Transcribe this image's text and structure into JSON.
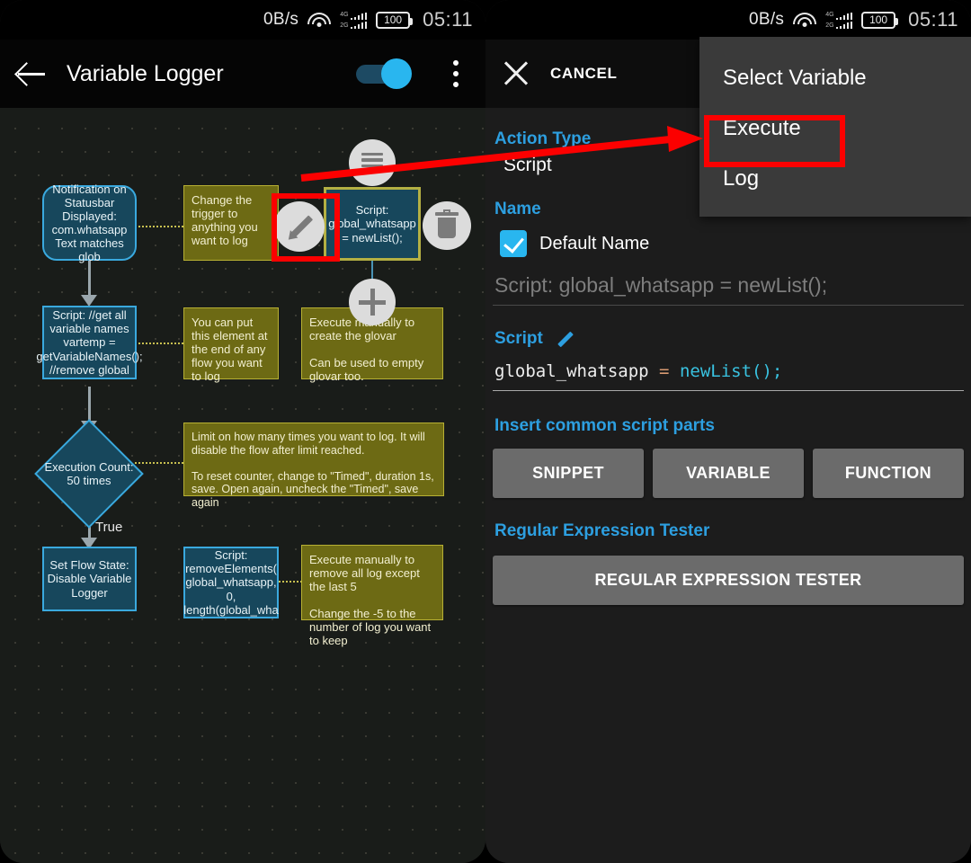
{
  "statusbar": {
    "speed": "0B/s",
    "battery": "100",
    "time": "05:11",
    "net_label_top": "4G",
    "net_label_bottom": "2G",
    "icons": [
      "wifi-icon",
      "signal-icon",
      "battery-icon"
    ]
  },
  "left_panel": {
    "appbar": {
      "title": "Variable Logger",
      "back_icon": "back-arrow-icon",
      "toggle_state": "on",
      "overflow_icon": "kebab-menu-icon"
    },
    "flow": {
      "nodes": [
        {
          "id": "trigger",
          "type": "trigger",
          "text": "Notification on Statusbar Displayed: com.whatsapp Text matches glob"
        },
        {
          "id": "script1",
          "type": "action",
          "text": "Script: //get all variable names vartemp = getVariableNames(); //remove global"
        },
        {
          "id": "count",
          "type": "condition",
          "text": "Execution Count: 50 times"
        },
        {
          "id": "flowstate",
          "type": "action",
          "text": "Set Flow State: Disable Variable Logger"
        },
        {
          "id": "script_sel",
          "type": "action-selected",
          "text": "Script: global_whatsapp = newList();"
        },
        {
          "id": "script2",
          "type": "action",
          "text": "Script: removeElements( global_whatsapp, 0, length(global_wha"
        }
      ],
      "notes": [
        {
          "id": "note1",
          "text": "Change the trigger to anything you want to log"
        },
        {
          "id": "note2",
          "text": "You can put this element at the end of any flow you want to log"
        },
        {
          "id": "note3",
          "text": "Execute manually to create the glovar\n\nCan be used to empty glovar too."
        },
        {
          "id": "note4",
          "text": "Limit on how many times you want to log. It will disable the flow after limit reached.\n\nTo reset counter, change to \"Timed\", duration 1s, save. Open again, uncheck the \"Timed\", save again"
        },
        {
          "id": "note5",
          "text": "Execute manually to remove all log except the last 5\n\nChange the -5 to the number of log you want to keep"
        }
      ],
      "edge_labels": {
        "true": "True"
      },
      "fabs": [
        {
          "id": "fab-menu",
          "icon": "hamburger-icon"
        },
        {
          "id": "fab-edit",
          "icon": "pencil-icon"
        },
        {
          "id": "fab-delete",
          "icon": "trash-icon"
        },
        {
          "id": "fab-add",
          "icon": "plus-icon"
        }
      ]
    }
  },
  "right_panel": {
    "appbar": {
      "close_icon": "close-x-icon",
      "cancel_label": "CANCEL",
      "confirm_icon": "check-icon"
    },
    "action_type": {
      "label": "Action Type",
      "value": "Script"
    },
    "name": {
      "label": "Name",
      "default_name_label": "Default Name",
      "default_name_checked": true,
      "name_placeholder": "Script: global_whatsapp = newList();"
    },
    "script": {
      "label": "Script",
      "edit_icon": "pencil-icon",
      "code_parts": {
        "var": "global_whatsapp",
        "op": "=",
        "fn": "newList();"
      },
      "code_full": "global_whatsapp = newList();"
    },
    "insert": {
      "label": "Insert common script parts",
      "buttons": [
        "SNIPPET",
        "VARIABLE",
        "FUNCTION"
      ]
    },
    "regex": {
      "label": "Regular Expression Tester",
      "button": "REGULAR EXPRESSION TESTER"
    }
  },
  "dropdown_menu": {
    "items": [
      "Select Variable",
      "Execute",
      "Log"
    ],
    "highlighted": "Execute"
  },
  "annotations": {
    "highlight_color": "#fc0000",
    "boxes": [
      "pencil-fab-highlight",
      "execute-menu-item-highlight"
    ],
    "arrow": "red-arrow-pointing-to-execute"
  },
  "colors": {
    "accent_blue": "#2d9fe0",
    "node_fill": "#17475c",
    "node_border": "#3aa9de",
    "note_fill": "#6d6a14",
    "selected_border": "#b4b043",
    "annotation_red": "#fc0000"
  }
}
